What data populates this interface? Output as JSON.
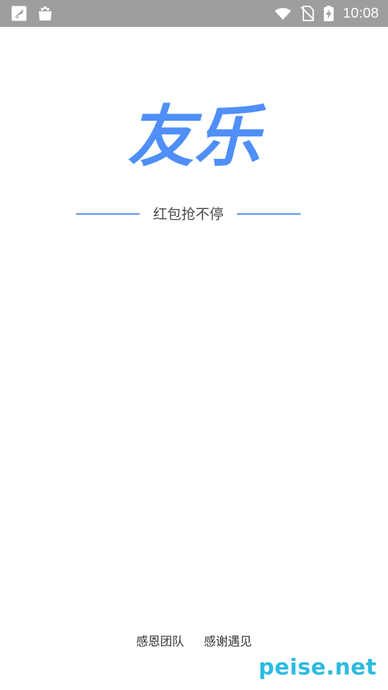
{
  "status_bar": {
    "time": "10:08",
    "icons": [
      "notification-app-icon",
      "notification-bag-icon",
      "wifi-icon",
      "no-sim-icon",
      "battery-charging-icon"
    ]
  },
  "splash": {
    "logo_text": "友乐",
    "slogan": "红包抢不停",
    "accent_color": "#5c8ff0"
  },
  "footer": {
    "link_1": "感恩团队",
    "link_2": "感谢遇见"
  },
  "watermark": {
    "text": "peise.net",
    "color": "#2bbbe0"
  }
}
